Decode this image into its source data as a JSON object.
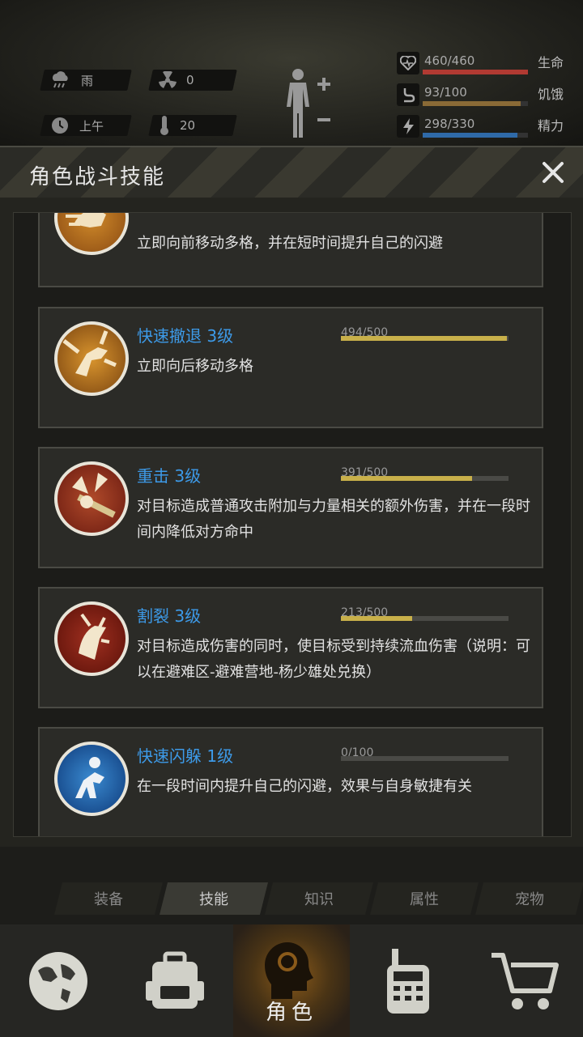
{
  "status": {
    "weather": "雨",
    "radiation": "0",
    "time_of_day": "上午",
    "temperature": "20"
  },
  "vitals": [
    {
      "name": "生命",
      "value": "460/460",
      "fraction": 1.0,
      "color": "#b13a32",
      "icon": "heart-icon"
    },
    {
      "name": "饥饿",
      "value": "93/100",
      "fraction": 0.93,
      "color": "#8a6a36",
      "icon": "stomach-icon"
    },
    {
      "name": "精力",
      "value": "298/330",
      "fraction": 0.9,
      "color": "#2f6aa8",
      "icon": "energy-icon"
    }
  ],
  "dialog": {
    "title": "角色战斗技能"
  },
  "skills": [
    {
      "name": "",
      "xp": "",
      "progress": null,
      "desc": "立即向前移动多格，并在短时间提升自己的闪避",
      "icon": "dash-forward-icon"
    },
    {
      "name": "快速撤退 3级",
      "xp": "494/500",
      "progress": 0.988,
      "desc": "立即向后移动多格",
      "icon": "retreat-icon"
    },
    {
      "name": "重击 3级",
      "xp": "391/500",
      "progress": 0.782,
      "desc": "对目标造成普通攻击附加与力量相关的额外伤害，并在一段时间内降低对方命中",
      "icon": "heavy-strike-icon"
    },
    {
      "name": "割裂 3级",
      "xp": "213/500",
      "progress": 0.426,
      "desc": "对目标造成伤害的同时，使目标受到持续流血伤害（说明：可以在避难区-避难营地-杨少雄处兑换）",
      "icon": "lacerate-icon"
    },
    {
      "name": "快速闪躲 1级",
      "xp": "0/100",
      "progress": 0.0,
      "desc": "在一段时间内提升自己的闪避，效果与自身敏捷有关",
      "icon": "quick-dodge-icon"
    }
  ],
  "sub_tabs": [
    "装备",
    "技能",
    "知识",
    "属性",
    "宠物"
  ],
  "nav": [
    {
      "icon": "globe-icon",
      "label": ""
    },
    {
      "icon": "backpack-icon",
      "label": ""
    },
    {
      "icon": "character-head-icon",
      "label": "角色"
    },
    {
      "icon": "radio-icon",
      "label": ""
    },
    {
      "icon": "cart-icon",
      "label": ""
    }
  ]
}
